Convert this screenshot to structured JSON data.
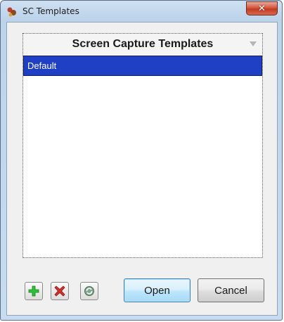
{
  "window": {
    "title": "SC Templates",
    "app_icon": "sc-app-icon",
    "close_glyph": "✕"
  },
  "template_list": {
    "header_title": "Screen Capture Templates",
    "items": [
      "Default"
    ],
    "selected_index": 0
  },
  "buttons": {
    "add_icon": "plus-icon",
    "delete_icon": "delete-x-icon",
    "refresh_icon": "refresh-icon",
    "open_label": "Open",
    "cancel_label": "Cancel"
  },
  "colors": {
    "selection": "#1f3fc4",
    "add_green": "#2fbf3a",
    "delete_red": "#d0312d",
    "close_red": "#c23a22",
    "open_blue": "#bee6fd"
  }
}
